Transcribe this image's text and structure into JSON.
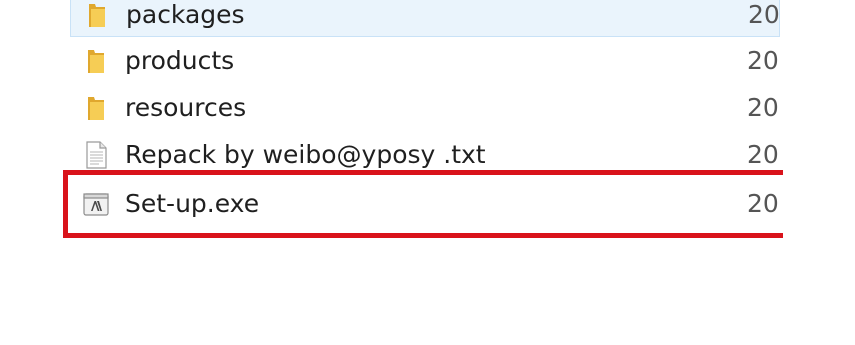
{
  "file_list": {
    "items": [
      {
        "name": "packages",
        "date": "20",
        "icon": "folder-icon",
        "selected": true
      },
      {
        "name": "products",
        "date": "20",
        "icon": "folder-icon",
        "selected": false
      },
      {
        "name": "resources",
        "date": "20",
        "icon": "folder-icon",
        "selected": false
      },
      {
        "name": "Repack by weibo@yposy .txt",
        "date": "20",
        "icon": "text-file-icon",
        "selected": false
      },
      {
        "name": "Set-up.exe",
        "date": "20",
        "icon": "adobe-installer-icon",
        "selected": false
      }
    ]
  },
  "colors": {
    "folder": "#f3c24a",
    "highlight": "#d9131b",
    "selection": "#eaf4fc"
  }
}
